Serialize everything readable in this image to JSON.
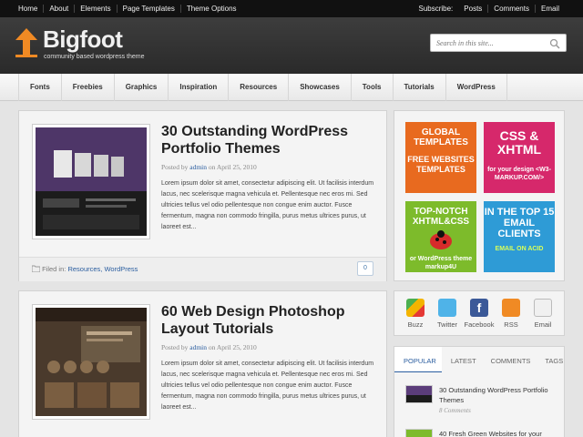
{
  "topbar": {
    "links": [
      "Home",
      "About",
      "Elements",
      "Page Templates",
      "Theme Options"
    ],
    "subscribe_label": "Subscribe:",
    "subscribe_links": [
      "Posts",
      "Comments",
      "Email"
    ]
  },
  "header": {
    "title": "Bigfoot",
    "tagline": "community based wordpress theme",
    "search_placeholder": "Search in this site..."
  },
  "nav": {
    "items": [
      "Fonts",
      "Freebies",
      "Graphics",
      "Inspiration",
      "Resources",
      "Showcases",
      "Tools",
      "Tutorials",
      "WordPress"
    ]
  },
  "posts": [
    {
      "title": "30 Outstanding WordPress Portfolio Themes",
      "posted_by": "Posted by",
      "author": "admin",
      "date": "on April 25, 2010",
      "excerpt": "Lorem ipsum dolor sit amet, consectetur adipiscing elit. Ut facilisis interdum lacus, nec scelerisque magna vehicula et. Pellentesque nec eros mi. Sed ultricies tellus vel odio pellentesque non congue enim auctor. Fusce fermentum, magna non commodo fringilla, purus metus ultrices purus, ut laoreet est...",
      "filed_in": "Filed in:",
      "categories": "Resources, WordPress",
      "comments": "0"
    },
    {
      "title": "60 Web Design Photoshop Layout Tutorials",
      "posted_by": "Posted by",
      "author": "admin",
      "date": "on April 25, 2010",
      "excerpt": "Lorem ipsum dolor sit amet, consectetur adipiscing elit. Ut facilisis interdum lacus, nec scelerisque magna vehicula et. Pellentesque nec eros mi. Sed ultricies tellus vel odio pellentesque non congue enim auctor. Fusce fermentum, magna non commodo fringilla, purus metus ultrices purus, ut laoreet est..."
    }
  ],
  "ads": [
    {
      "l1": "GLOBAL TEMPLATES",
      "l2": "FREE WEBSITES TEMPLATES"
    },
    {
      "l1": "CSS & XHTML",
      "l2": "for your design <W3-MARKUP.COM/>"
    },
    {
      "l1": "TOP-NOTCH XHTML&CSS",
      "l2": "or WordPress theme markup4U"
    },
    {
      "l1": "IN THE TOP 15 EMAIL CLIENTS",
      "l2": "EMAIL ON ACID"
    }
  ],
  "social": [
    {
      "label": "Buzz",
      "color": "#f4b400"
    },
    {
      "label": "Twitter",
      "color": "#4fb3e8"
    },
    {
      "label": "Facebook",
      "color": "#3b5998"
    },
    {
      "label": "RSS",
      "color": "#f08a24"
    },
    {
      "label": "Email",
      "color": "#cfcfcf"
    }
  ],
  "tabs": {
    "labels": [
      "POPULAR",
      "LATEST",
      "COMMENTS",
      "TAGS"
    ],
    "entries": [
      {
        "title": "30 Outstanding WordPress Portfolio Themes",
        "count": "8 Comments"
      },
      {
        "title": "40 Fresh Green Websites for your",
        "count": ""
      }
    ]
  }
}
